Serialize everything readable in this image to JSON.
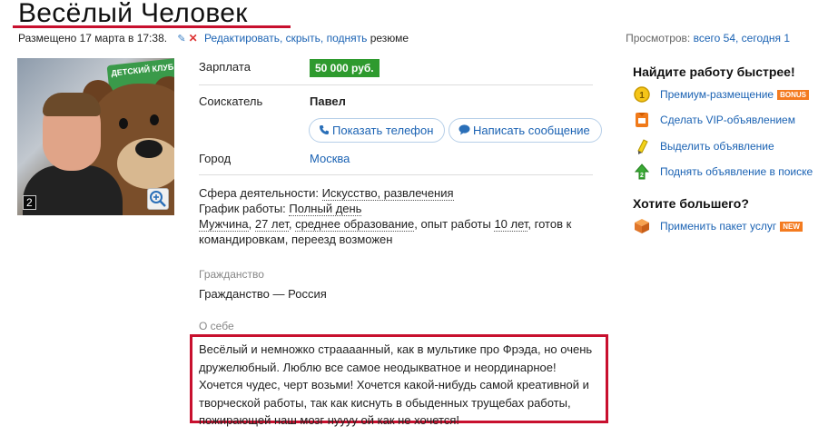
{
  "header": {
    "title": "Весёлый Человек",
    "posted": "Размещено 17 марта в 17:38.",
    "actions": "Редактировать, скрыть, поднять",
    "actions_suffix": " резюме",
    "views_label": "Просмотров:",
    "views_value": "всего 54, сегодня 1"
  },
  "photo": {
    "count": "2",
    "sign_text": "ДЕТСКИЙ КЛУБ"
  },
  "fields": {
    "salary_label": "Зарплата",
    "salary_value": "50 000 руб.",
    "applicant_label": "Соискатель",
    "applicant_value": "Павел",
    "show_phone": "Показать телефон",
    "send_message": "Написать сообщение",
    "city_label": "Город",
    "city_value": "Москва"
  },
  "details": {
    "field_label": "Сфера деятельности:",
    "field_value": "Искусство, развлечения",
    "schedule_label": "График работы:",
    "schedule_value": "Полный день",
    "gender": "Мужчина",
    "age": "27 лет",
    "education": "среднее образование",
    "experience_label": ", опыт работы ",
    "experience_value": "10 лет",
    "extra": ", готов к командировкам, переезд возможен"
  },
  "citizenship": {
    "label": "Гражданство",
    "value": "Гражданство — Россия"
  },
  "about": {
    "label": "О себе",
    "text": "Весёлый и немножко страааанный, как в мультике про Фрэда, но очень дружелюбный. Люблю все самое неодыкватное и неординарное! Хочется чудес, черт возьми! Хочется какой-нибудь самой креативной и творческой работы, так как киснуть в обыденных трущебах работы, пожирающей наш мозг нуууу ой как не хочется!"
  },
  "sidebar": {
    "heading1": "Найдите работу быстрее!",
    "items": [
      {
        "label": "Премиум-размещение",
        "tag": "BONUS",
        "icon": "premium-coin-icon"
      },
      {
        "label": "Сделать VIP-объявлением",
        "icon": "vip-icon"
      },
      {
        "label": "Выделить объявление",
        "icon": "highlight-marker-icon"
      },
      {
        "label": "Поднять объявление в поиске",
        "icon": "raise-arrow-icon"
      }
    ],
    "heading2": "Хотите большего?",
    "package": {
      "label": "Применить пакет услуг",
      "tag": "NEW",
      "icon": "package-box-icon"
    }
  },
  "colors": {
    "accent_red": "#c8102e",
    "link_blue": "#1a62b3",
    "salary_green": "#2e9a2e",
    "tag_orange": "#f47b20"
  }
}
